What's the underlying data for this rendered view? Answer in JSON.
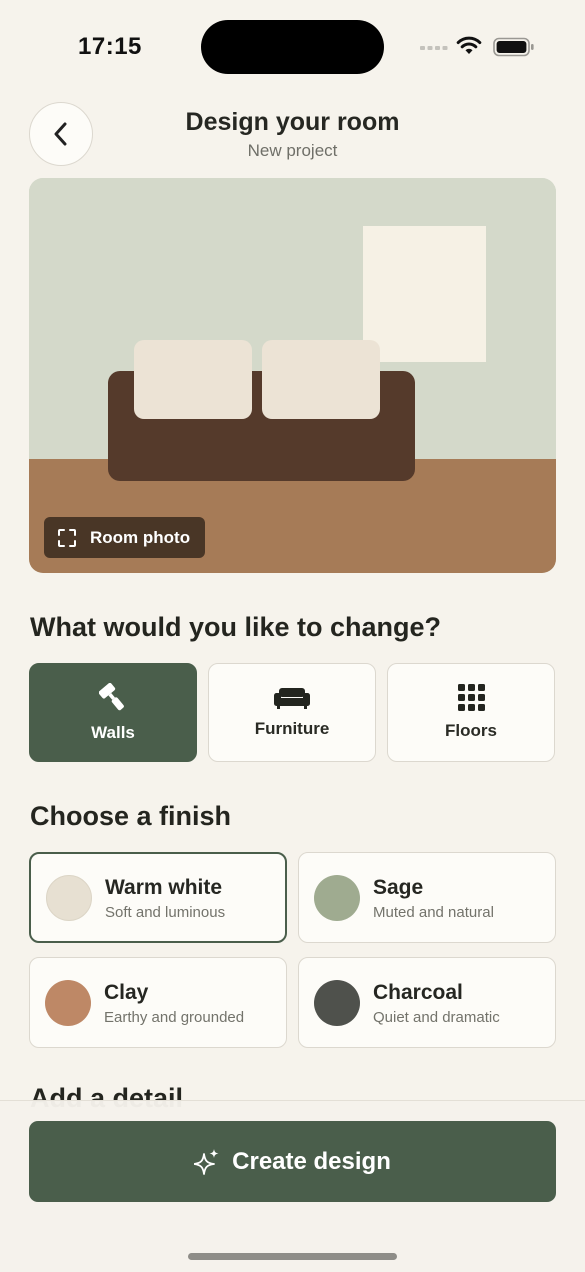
{
  "status_bar": {
    "time": "17:15"
  },
  "header": {
    "back_icon": "chevron-left-icon",
    "title": "Design your room",
    "subtitle": "New project"
  },
  "preview": {
    "badge_label": "Room photo",
    "badge_icon": "viewfinder-icon",
    "colors": {
      "wall": "#d4d9ca",
      "floor": "#a67b57",
      "sofa": "#553a2b",
      "cushion": "#ece3d5",
      "frame": "#f6f1e5"
    }
  },
  "change_section": {
    "title": "What would you like to change?",
    "options": [
      {
        "label": "Walls",
        "icon": "paint-roller-icon",
        "active": true
      },
      {
        "label": "Furniture",
        "icon": "sofa-icon",
        "active": false
      },
      {
        "label": "Floors",
        "icon": "grid-icon",
        "active": false
      }
    ]
  },
  "finish_section": {
    "title": "Choose a finish",
    "finishes": [
      {
        "name": "Warm white",
        "desc": "Soft and luminous",
        "color": "#e7e0d2",
        "selected": true
      },
      {
        "name": "Sage",
        "desc": "Muted and natural",
        "color": "#9fab90",
        "selected": false
      },
      {
        "name": "Clay",
        "desc": "Earthy and grounded",
        "color": "#be8866",
        "selected": false
      },
      {
        "name": "Charcoal",
        "desc": "Quiet and dramatic",
        "color": "#4f514c",
        "selected": false
      }
    ]
  },
  "detail_section": {
    "title": "Add a detail"
  },
  "cta": {
    "label": "Create design",
    "icon": "sparkle-icon"
  },
  "colors": {
    "accent": "#4a5e4b",
    "background": "#f6f3ec",
    "card": "#fdfcf8"
  }
}
